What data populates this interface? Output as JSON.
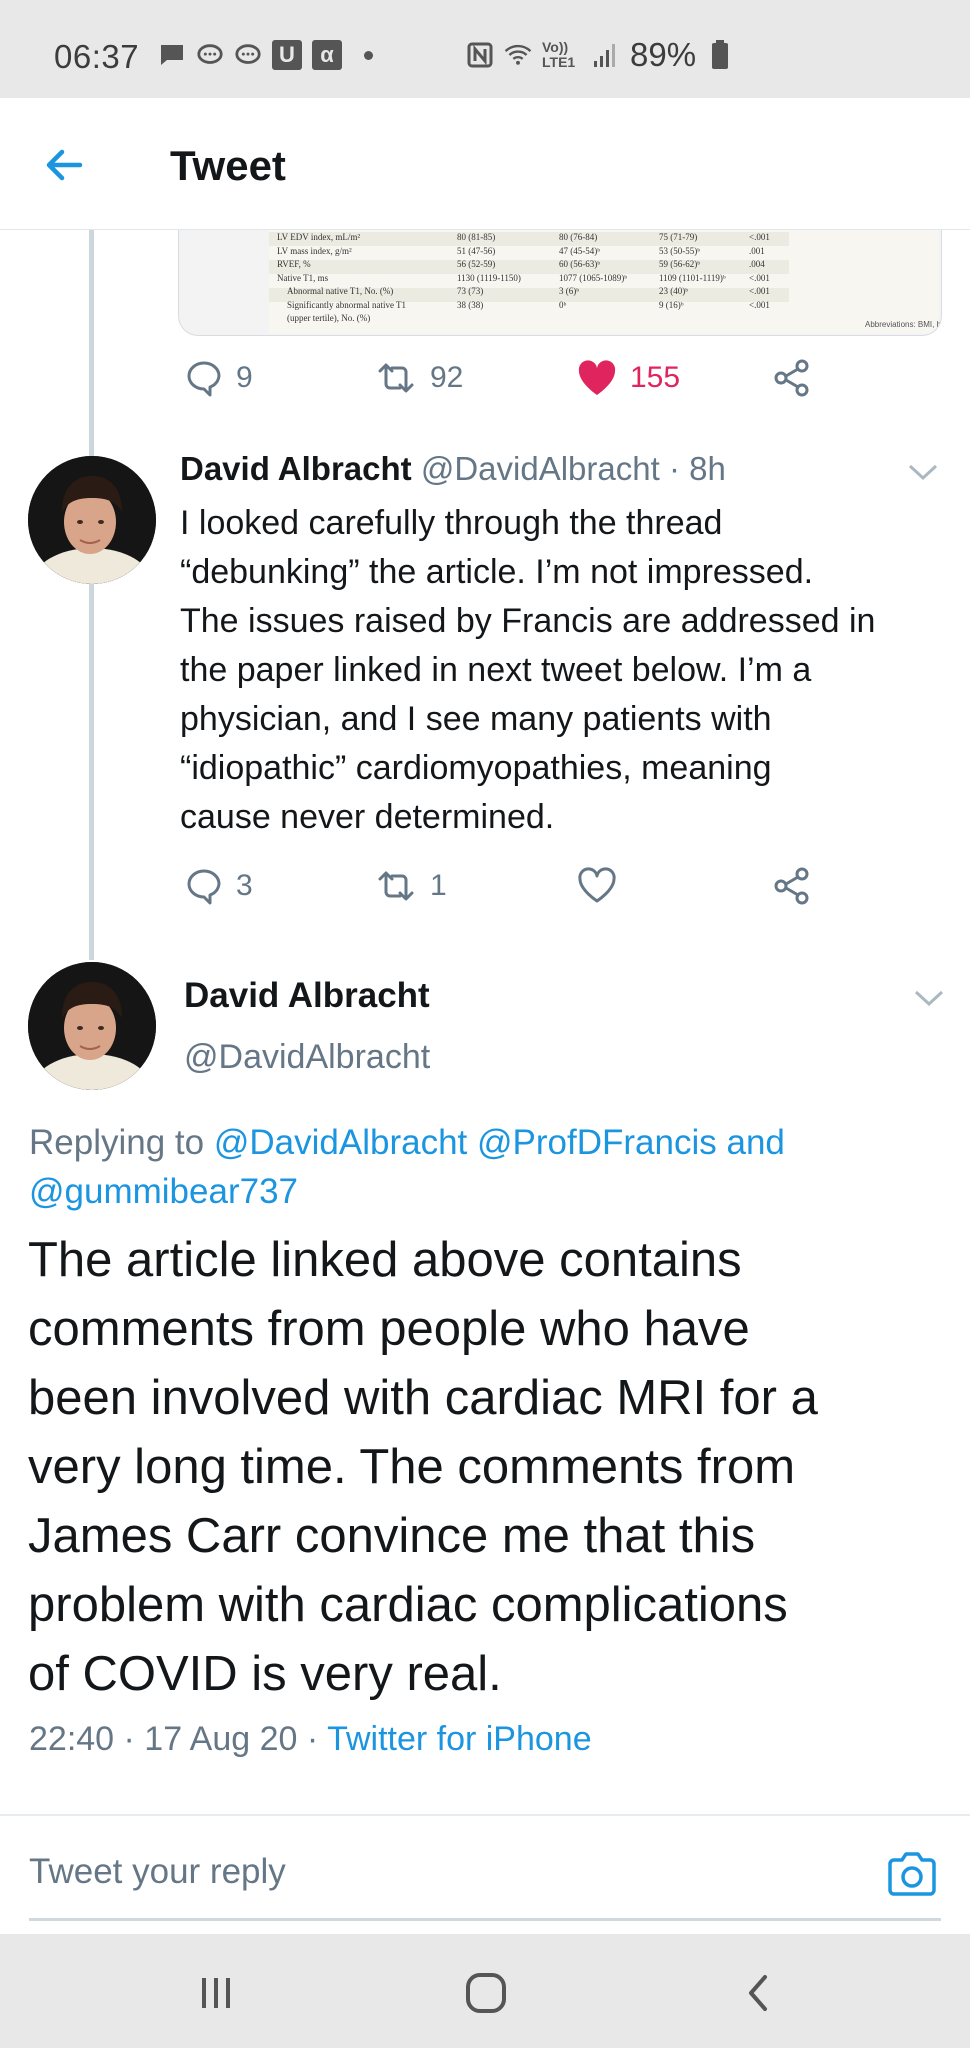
{
  "status_bar": {
    "time": "06:37",
    "battery_text": "89%",
    "network_label": "Vo)) LTE1",
    "left_icons": [
      "chat-icon",
      "message-icon",
      "message-icon",
      "u-app-icon",
      "alpha-app-icon",
      "dot-icon"
    ],
    "right_icons": [
      "nfc-icon",
      "wifi-icon",
      "signal-icon",
      "battery-icon"
    ]
  },
  "header": {
    "title": "Tweet"
  },
  "media_table": {
    "rows": [
      [
        "LV EDV index, mL/m²",
        "80 (81-85)",
        "80 (76-84)",
        "75 (71-79)",
        "<.001"
      ],
      [
        "LV mass index, g/m²",
        "51 (47-56)",
        "47 (45-54)ᵇ",
        "53 (50-55)ᵇ",
        ".001"
      ],
      [
        "RVEF, %",
        "56 (52-59)",
        "60 (56-63)ᵇ",
        "59 (56-62)ᵇ",
        ".004"
      ],
      [
        "Native T1, ms",
        "1130 (1119-1150)",
        "1077 (1065-1089)ᵇ",
        "1109 (1101-1119)ᵇ",
        "<.001"
      ],
      [
        "Abnormal native T1, No. (%)",
        "73 (73)",
        "3 (6)ᵇ",
        "23 (40)ᵇ",
        "<.001"
      ],
      [
        "Significantly abnormal native T1",
        "38 (38)",
        "0ᵇ",
        "9 (16)ᵇ",
        "<.001"
      ],
      [
        "(upper tertile), No. (%)",
        "",
        "",
        "",
        ""
      ]
    ],
    "abbreviations": "Abbreviations: BMI, body mass index;"
  },
  "tweet0_actions": {
    "replies": "9",
    "retweets": "92",
    "likes": "155"
  },
  "tweet1": {
    "name": "David Albracht",
    "handle": "@DavidAlbracht",
    "time": "· 8h",
    "lines": [
      "I looked carefully through the thread",
      "“debunking” the article. I’m not impressed.",
      "The issues raised by Francis are addressed in",
      "the paper linked in next tweet below. I’m a",
      "physician, and I see many patients with",
      "“idiopathic” cardiomyopathies, meaning",
      "cause never determined."
    ],
    "replies": "3",
    "retweets": "1"
  },
  "tweet2": {
    "name": "David Albracht",
    "handle": "@DavidAlbracht",
    "replying_prefix": "Replying to",
    "mention1": "@DavidAlbracht",
    "mention2": "@ProfDFrancis",
    "and_text": "and",
    "mention3": "@gummibear737",
    "lines": [
      "The article linked above contains",
      "comments from people who have",
      "been involved with cardiac MRI for a",
      "very long time. The comments from",
      "James Carr convince me that this",
      "problem with cardiac complications",
      "of COVID is very real."
    ],
    "timestamp": "22:40 · 17 Aug 20 ·",
    "source": "Twitter for iPhone"
  },
  "reply": {
    "placeholder": "Tweet your reply"
  },
  "colors": {
    "accent": "#1b95e0",
    "like": "#e0245e",
    "muted": "#657786"
  }
}
